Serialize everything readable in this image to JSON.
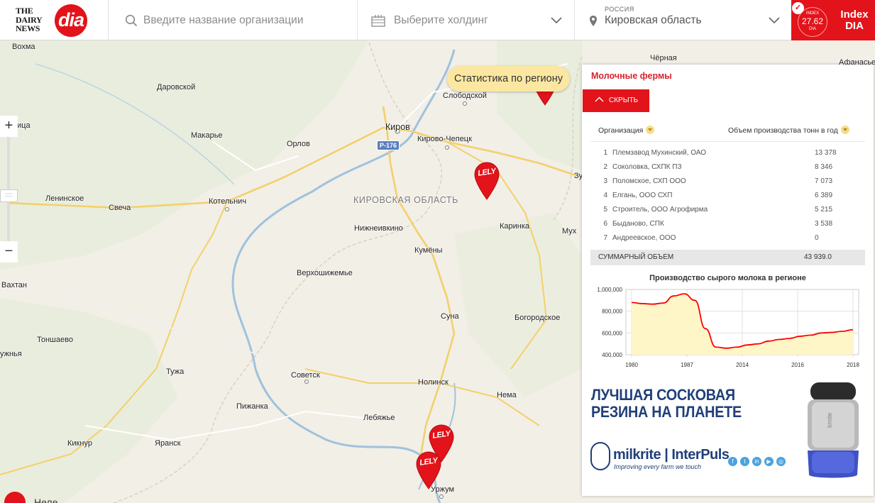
{
  "header": {
    "logo_tdn": [
      "THE",
      "DAIRY",
      "NEWS"
    ],
    "logo_dia": "dia",
    "search_placeholder": "Введите название организации",
    "holding_placeholder": "Выберите холдинг",
    "country": "РОССИЯ",
    "region": "Кировская область",
    "index": {
      "top": "INDEX",
      "value": "27.62",
      "bottom": "DIA",
      "title": "Index DIA"
    }
  },
  "map": {
    "region_label": "КИРОВСКАЯ ОБЛАСТЬ",
    "road": "Р-176",
    "cities": [
      "Вохма",
      "Даровской",
      "Слободской",
      "Чёрная",
      "Афанасье",
      "Киров",
      "Кирово-Чепецк",
      "Макарьe",
      "Орлов",
      "Зу",
      "Ленинское",
      "Свеча",
      "Котельнич",
      "Нижнеивкино",
      "Каринка",
      "Мух",
      "Кумёны",
      "Верхошижемье",
      "Вахтан",
      "Суна",
      "Богородское",
      "Тоншаево",
      "ужнья",
      "Тужа",
      "Советск",
      "Нолинск",
      "Нема",
      "Пижанка",
      "Лебяжье",
      "Кикнур",
      "Яранск",
      "Уржум",
      "ица",
      "Неле"
    ],
    "tooltip": "Статистика по региону",
    "marker_text": "LELY",
    "zoom_in": "+",
    "zoom_out": "−",
    "zoom_handle": ":::::"
  },
  "panel": {
    "title": "Молочные фермы",
    "hide_label": "СКРЫТЬ",
    "col_org": "Организация",
    "col_volume": "Объем производства тонн в год",
    "farms": [
      {
        "n": "1",
        "name": "Племзавод Мухинский, ОАО",
        "volume": "13 378"
      },
      {
        "n": "2",
        "name": "Соколовка, СХПК ПЗ",
        "volume": "8 346"
      },
      {
        "n": "3",
        "name": "Поломское, СХП ООО",
        "volume": "7 073"
      },
      {
        "n": "4",
        "name": "Елгань, ООО СХП",
        "volume": "6 389"
      },
      {
        "n": "5",
        "name": "Строитель, ООО Агрофирма",
        "volume": "5 215"
      },
      {
        "n": "6",
        "name": "Быданово, СПК",
        "volume": "3 538"
      },
      {
        "n": "7",
        "name": "Андреевское, ООО",
        "volume": "0"
      }
    ],
    "total_label": "СУММАРНЫЙ ОБЪЕМ",
    "total_value": "43 939.0"
  },
  "chart_data": {
    "type": "area",
    "title": "Производство сырого молока в регионе",
    "x_ticks": [
      "1980",
      "1987",
      "2014",
      "2016",
      "2018"
    ],
    "y_ticks": [
      "1,000,000",
      "800,000",
      "600,000",
      "400,000"
    ],
    "ylim": [
      400000,
      1000000
    ],
    "series": [
      {
        "values": [
          880000,
          870000,
          865000,
          875000,
          940000,
          960000,
          900000,
          640000,
          470000,
          460000,
          470000,
          490000,
          500000,
          525000,
          540000,
          550000,
          570000,
          580000,
          600000,
          605000,
          615000,
          630000
        ]
      }
    ],
    "color_line": "#ff0000",
    "color_fill": "#fff6c7",
    "grid": true
  },
  "ad": {
    "line1": "ЛУЧШАЯ СОСКОВАЯ",
    "line2": "РЕЗИНА НА ПЛАНЕТЕ",
    "brand": "milkrite | InterPuls",
    "slogan": "Improving every farm we touch",
    "product_text": "kmite"
  },
  "corner": {
    "text": "Неле"
  },
  "colors": {
    "accent": "#e2131a",
    "tooltip": "#fbe7a1",
    "panel_title": "#d9232c"
  }
}
